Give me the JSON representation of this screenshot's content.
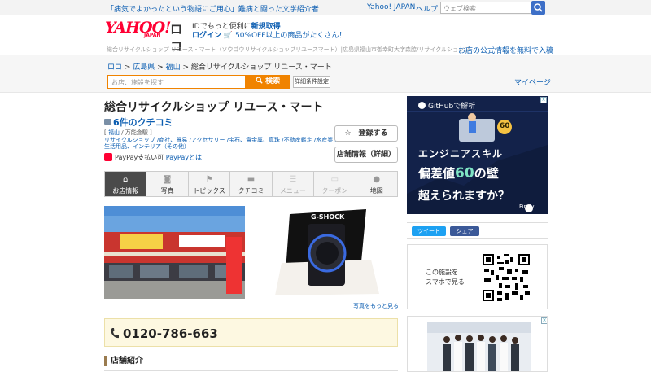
{
  "topbar": {
    "promo": "「病気でよかったという物語にご用心」難病と闘った文学紹介者",
    "yahoo_japan": "Yahoo! JAPAN",
    "help": "ヘルプ",
    "search_placeholder": "ウェブ検索"
  },
  "header": {
    "logo_main": "YAHOO!",
    "logo_sub": "JAPAN",
    "logo_loco": "ロコ",
    "line1_prefix": "IDでもっと便利に",
    "line1_link": "新規取得",
    "login": "ログイン",
    "line2_rest": "50%OFF以上の商品がたくさん！",
    "subline": "総合リサイクルショップ リユース・マート（ソウゴウリサイクルショップリユースマート）|広島県福山市御幸町大字森脇/リサイクルショップ",
    "free_info": "お店の公式情報を無料で入稿"
  },
  "breadcrumb": {
    "items": [
      "ロコ",
      "広島県",
      "福山",
      "総合リサイクルショップ リユース・マート"
    ],
    "sep": " > "
  },
  "search": {
    "placeholder": "お店、施設を探す",
    "button": "検索",
    "advanced": "詳細条件設定",
    "mypage": "マイページ"
  },
  "shop": {
    "title": "総合リサイクルショップ リユース・マート",
    "reviews": "6件のクチコミ",
    "area_bracket_open": "[ ",
    "area": "福山",
    "area_sep": " / ",
    "station": "万能倉駅",
    "area_bracket_close": " ]",
    "categories_line1": "リサイクルショップ /商社、貿易 /アクセサリー /宝石、貴金属、真珠 /不動産鑑定 /水産業 /",
    "categories_line2": "生活用品、インテリア（その他）",
    "paypay_label": "PayPay支払い可",
    "paypay_link": "PayPayとは",
    "register_button": "☆　登録する",
    "info_button": "店舗情報（詳細）"
  },
  "tabs": [
    {
      "label": "お店情報",
      "icon": "home-icon"
    },
    {
      "label": "写真",
      "icon": "camera-icon"
    },
    {
      "label": "トピックス",
      "icon": "flag-icon"
    },
    {
      "label": "クチコミ",
      "icon": "speech-icon"
    },
    {
      "label": "メニュー",
      "icon": "menu-icon"
    },
    {
      "label": "クーポン",
      "icon": "ticket-icon"
    },
    {
      "label": "地図",
      "icon": "pin-icon"
    }
  ],
  "photos": {
    "more": "写真をもっと見る",
    "watch_brand": "G-SHOCK"
  },
  "phone": {
    "number": "0120-786-663"
  },
  "section": {
    "title": "店舗紹介"
  },
  "ad1": {
    "brand": "GitHubで解析",
    "line1": "エンジニアスキル",
    "line2_a": "偏差値",
    "line2_b": "60",
    "line2_c": "の壁",
    "line3": "超えられますか？",
    "badge": "60",
    "sponsor": "Findy"
  },
  "share": {
    "tweet": "ツイート",
    "share": "シェア"
  },
  "qr": {
    "line1": "この施設を",
    "line2": "スマホで見る"
  },
  "colors": {
    "yahoo_red": "#ff0033",
    "link_blue": "#0b5db1",
    "search_orange": "#f08300",
    "active_tab": "#4a4a4a",
    "phone_bg": "#fdf8e1"
  }
}
